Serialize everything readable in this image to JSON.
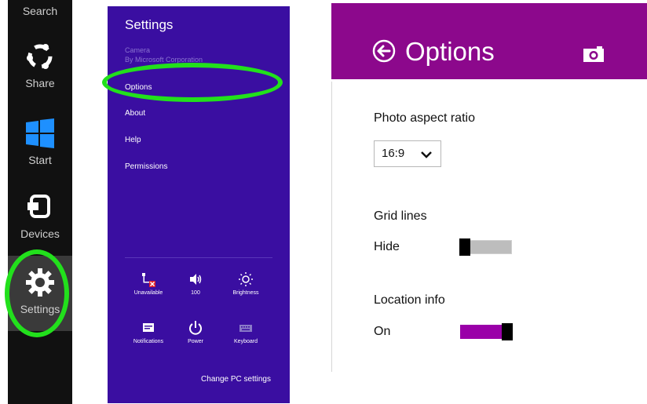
{
  "charms": {
    "search": "Search",
    "share": "Share",
    "start": "Start",
    "devices": "Devices",
    "settings": "Settings"
  },
  "settings_pane": {
    "title": "Settings",
    "app_name": "Camera",
    "app_publisher": "By Microsoft Corporation",
    "items": [
      "Options",
      "About",
      "Help",
      "Permissions"
    ],
    "quick_settings": [
      {
        "label": "Unavailable",
        "icon": "network-unavailable-icon"
      },
      {
        "label": "100",
        "icon": "volume-icon"
      },
      {
        "label": "Brightness",
        "icon": "brightness-icon"
      },
      {
        "label": "Notifications",
        "icon": "notifications-icon"
      },
      {
        "label": "Power",
        "icon": "power-icon"
      },
      {
        "label": "Keyboard",
        "icon": "keyboard-icon"
      }
    ],
    "change_pc_settings": "Change PC settings"
  },
  "options_pane": {
    "title": "Options",
    "photo_aspect_ratio_label": "Photo aspect ratio",
    "photo_aspect_ratio_value": "16:9",
    "grid_lines_label": "Grid lines",
    "grid_lines_value": "Hide",
    "grid_lines_on": false,
    "location_info_label": "Location info",
    "location_info_value": "On",
    "location_info_on": true
  },
  "colors": {
    "settings_pane_bg": "#3a0ea1",
    "options_header_bg": "#8c088c",
    "highlight_ring": "#22e01c",
    "charms_bg": "#111111"
  }
}
